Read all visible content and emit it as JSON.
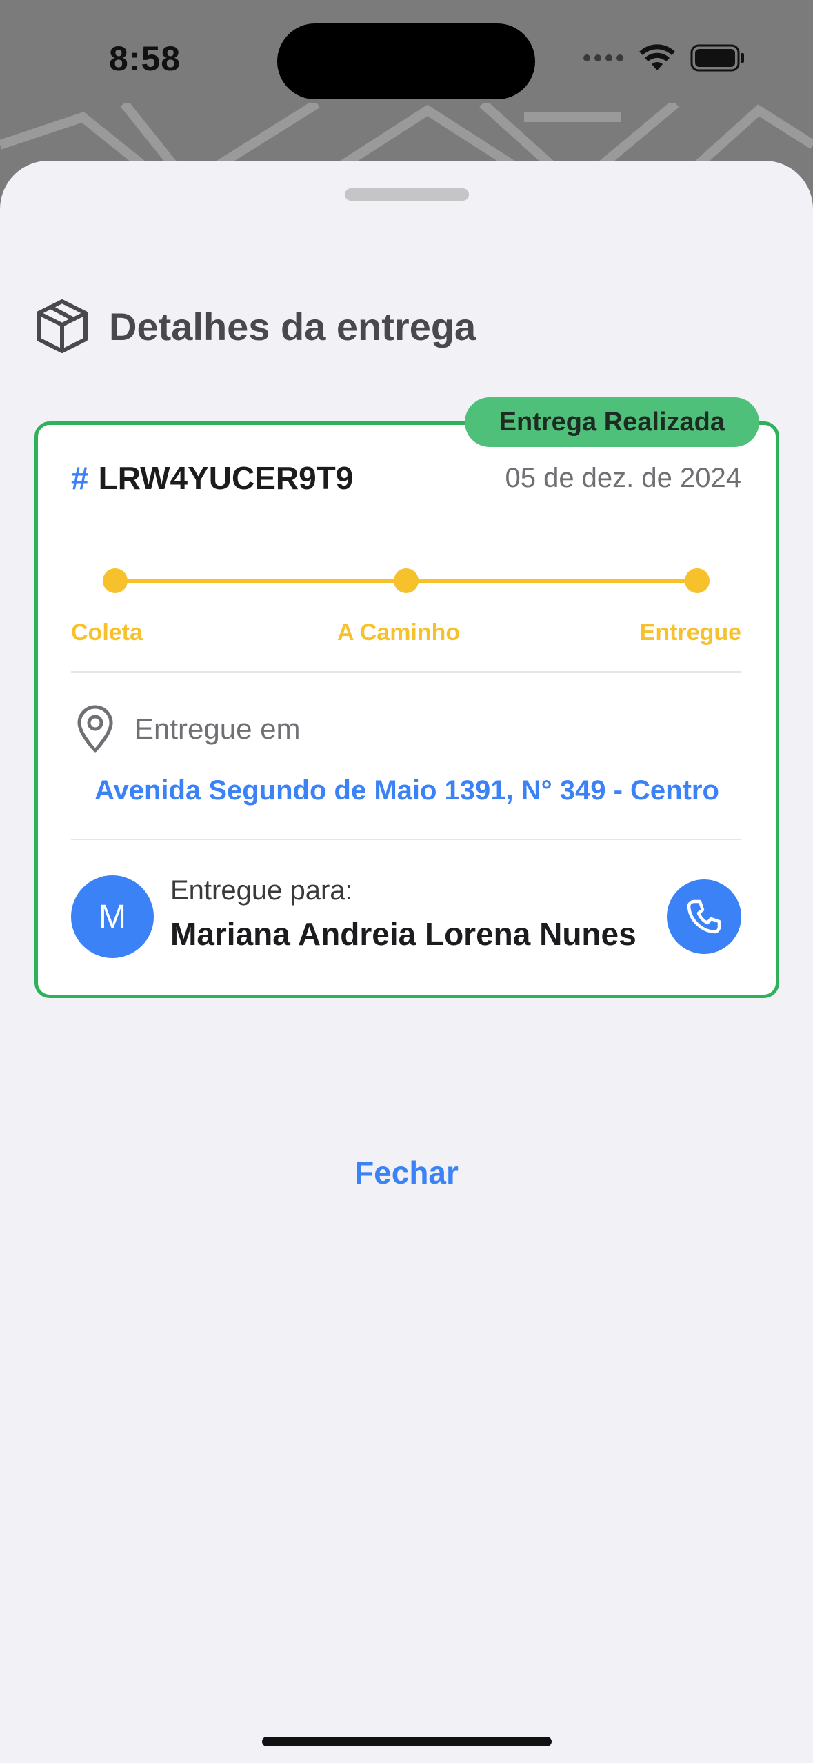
{
  "status_bar": {
    "time": "8:58"
  },
  "sheet": {
    "title": "Detalhes da entrega",
    "title_icon": "package-icon"
  },
  "card": {
    "status_badge": "Entrega Realizada",
    "order_hash": "#",
    "order_id": "LRW4YUCER9T9",
    "date": "05 de dez. de 2024",
    "steps": [
      {
        "label": "Coleta"
      },
      {
        "label": "A Caminho"
      },
      {
        "label": "Entregue"
      }
    ],
    "delivered_at_label": "Entregue em",
    "address": "Avenida Segundo de Maio 1391, N° 349 - Centro",
    "recipient_label": "Entregue para:",
    "recipient_initial": "M",
    "recipient_name": "Mariana Andreia Lorena Nunes"
  },
  "close_label": "Fechar",
  "colors": {
    "accent": "#3b82f6",
    "success_border": "#2fb05a",
    "success_badge": "#4fc07a",
    "progress": "#f7c12c"
  }
}
